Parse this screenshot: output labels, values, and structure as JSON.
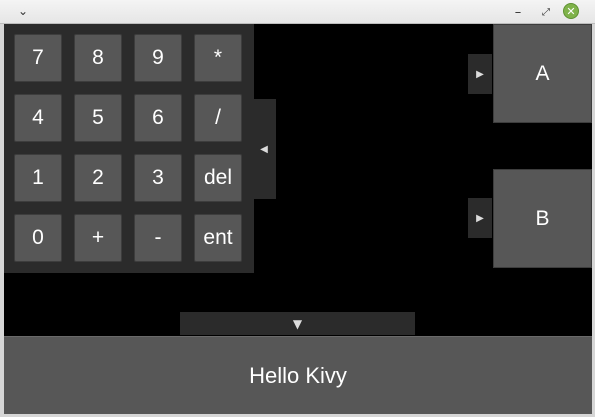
{
  "titlebar": {
    "menu_icon": "chevron-down-icon",
    "menu_glyph": "⌄",
    "minimize_glyph": "–",
    "maximize_glyph": "⤢",
    "close_glyph": "✕"
  },
  "keypad": {
    "keys": [
      "7",
      "8",
      "9",
      "*",
      "4",
      "5",
      "6",
      "/",
      "1",
      "2",
      "3",
      "del",
      "0",
      "+",
      "-",
      "ent"
    ]
  },
  "tabs": {
    "left_glyph": "◀",
    "down_glyph": "▼",
    "right_a_glyph": "▶",
    "right_b_glyph": "▶"
  },
  "buttons": {
    "a_label": "A",
    "b_label": "B",
    "hello_label": "Hello Kivy"
  },
  "colors": {
    "button_bg": "#575757",
    "panel_bg": "#2b2b2b",
    "canvas_bg": "#000000",
    "close_green": "#7fb24a"
  }
}
